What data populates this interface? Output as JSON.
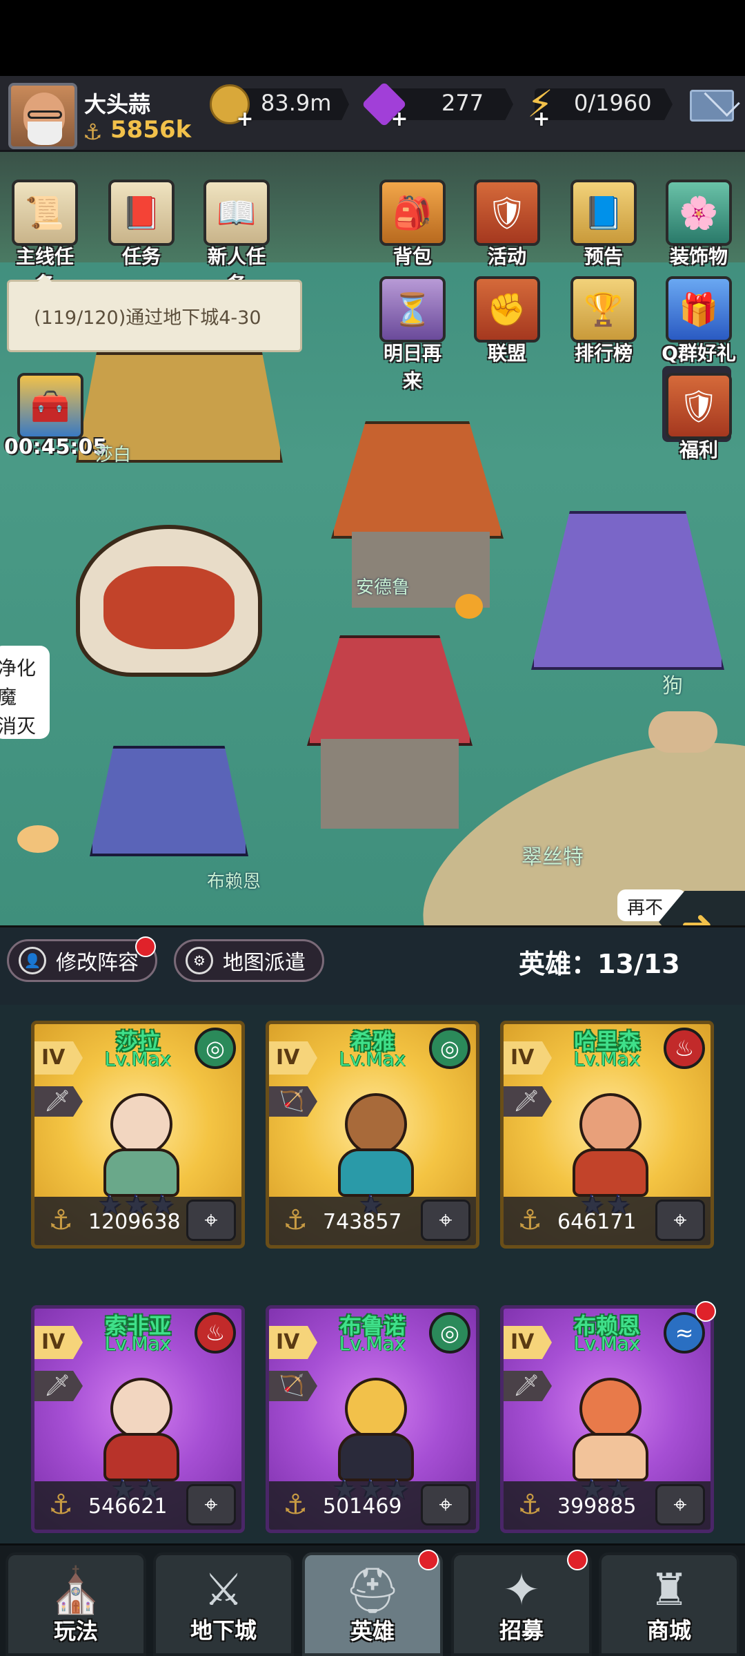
{
  "player": {
    "name": "大头蒜",
    "power": "5856k"
  },
  "resources": {
    "gold": "83.9m",
    "gems": "277",
    "energy": "0/1960"
  },
  "map_buttons_left": [
    {
      "label": "主线任务",
      "icon": "scroll-icon"
    },
    {
      "label": "任务",
      "icon": "book-icon"
    },
    {
      "label": "新人任务",
      "icon": "open-book-icon"
    }
  ],
  "map_buttons_right_row1": [
    {
      "label": "背包",
      "icon": "backpack-icon"
    },
    {
      "label": "活动",
      "icon": "shield-icon"
    },
    {
      "label": "预告",
      "icon": "book-icon"
    },
    {
      "label": "装饰物",
      "icon": "bush-icon"
    }
  ],
  "map_buttons_right_row2": [
    {
      "label": "明日再来",
      "icon": "hourglass-icon"
    },
    {
      "label": "联盟",
      "icon": "fist-icon"
    },
    {
      "label": "排行榜",
      "icon": "trophy-icon"
    },
    {
      "label": "Q群好礼",
      "icon": "qq-gift-icon"
    }
  ],
  "map_button_welfare": {
    "label": "福利",
    "icon": "shield-icon"
  },
  "quest_tip": "(119/120)通过地下城4-30",
  "chest_timer": "00:45:05",
  "map_labels": {
    "shabai": "莎白",
    "andelu": "安德鲁",
    "gou": "狗",
    "cuisite": "翠丝特",
    "bulaien": "布赖恩"
  },
  "side_bubble": {
    "line1": "净化魔",
    "line2": "消灭"
  },
  "next_bubble": "再不",
  "team": {
    "edit_lineup": "修改阵容",
    "map_dispatch": "地图派遣",
    "hero_count": "英雄：13/13"
  },
  "heroes": [
    {
      "name": "莎拉",
      "level": "Lv.Max",
      "tier": "IV",
      "element": "wind",
      "power": "1209638",
      "stars": "★★★",
      "rarity": "gold"
    },
    {
      "name": "希雅",
      "level": "Lv.Max",
      "tier": "IV",
      "element": "wind",
      "power": "743857",
      "stars": "★",
      "rarity": "gold"
    },
    {
      "name": "哈里森",
      "level": "Lv.Max",
      "tier": "IV",
      "element": "fire",
      "power": "646171",
      "stars": "★★",
      "rarity": "gold"
    },
    {
      "name": "索非亚",
      "level": "Lv.Max",
      "tier": "IV",
      "element": "fire",
      "power": "546621",
      "stars": "★★",
      "rarity": "purple"
    },
    {
      "name": "布鲁诺",
      "level": "Lv.Max",
      "tier": "IV",
      "element": "wind",
      "power": "501469",
      "stars": "★★★",
      "rarity": "purple"
    },
    {
      "name": "布赖恩",
      "level": "Lv.Max",
      "tier": "IV",
      "element": "water",
      "power": "399885",
      "stars": "★★",
      "rarity": "purple"
    }
  ],
  "nav": [
    {
      "label": "玩法",
      "icon": "castle-icon"
    },
    {
      "label": "地下城",
      "icon": "crossed-swords-icon"
    },
    {
      "label": "英雄",
      "icon": "helmet-icon"
    },
    {
      "label": "招募",
      "icon": "summon-icon"
    },
    {
      "label": "商城",
      "icon": "tower-icon"
    }
  ],
  "colors": {
    "gold_text": "#f2c14a",
    "hero_name_green": "#3fe08a",
    "notification_red": "#e0222a"
  }
}
